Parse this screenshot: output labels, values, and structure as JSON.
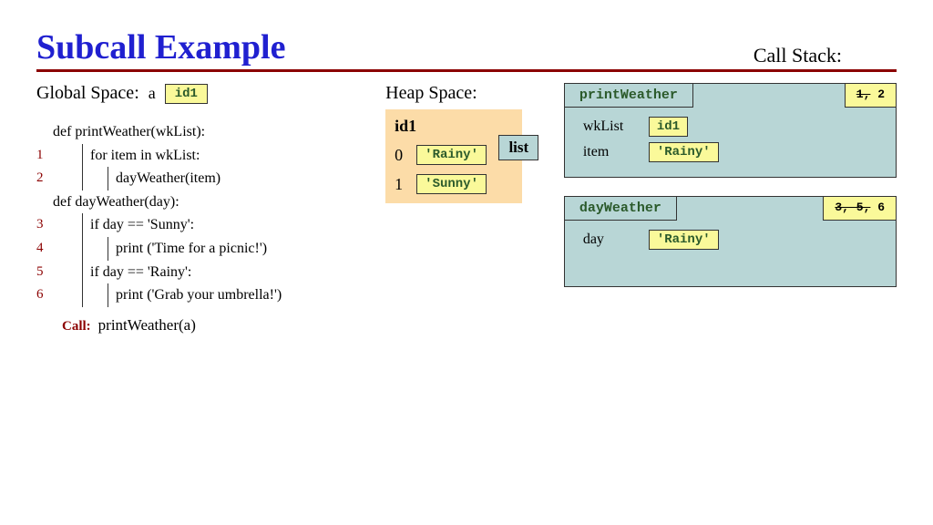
{
  "title": "Subcall Example",
  "callstack_label": "Call Stack:",
  "global": {
    "label": "Global Space:",
    "var_name": "a",
    "var_value": "id1"
  },
  "code": {
    "lines": [
      {
        "ln": "",
        "indent": 0,
        "text": "def printWeather(wkList):"
      },
      {
        "ln": "1",
        "indent": 1,
        "text": "for item in wkList:"
      },
      {
        "ln": "2",
        "indent": 2,
        "text": "dayWeather(item)"
      },
      {
        "ln": "",
        "indent": 0,
        "text": "def dayWeather(day):"
      },
      {
        "ln": "3",
        "indent": 1,
        "text": "if day == 'Sunny':"
      },
      {
        "ln": "4",
        "indent": 2,
        "text": "print ('Time for a picnic!')"
      },
      {
        "ln": "5",
        "indent": 1,
        "text": "if day == 'Rainy':"
      },
      {
        "ln": "6",
        "indent": 2,
        "text": "print ('Grab your umbrella!')"
      }
    ],
    "call_label": "Call:",
    "call_text": "printWeather(a)"
  },
  "heap": {
    "label": "Heap Space:",
    "obj_id": "id1",
    "obj_type": "list",
    "items": [
      {
        "idx": "0",
        "val": "'Rainy'"
      },
      {
        "idx": "1",
        "val": "'Sunny'"
      }
    ]
  },
  "stack": [
    {
      "name": "printWeather",
      "counter_struck": "1,",
      "counter_cur": " 2",
      "vars": [
        {
          "name": "wkList",
          "val": "id1"
        },
        {
          "name": "item",
          "val": "'Rainy'"
        }
      ]
    },
    {
      "name": "dayWeather",
      "counter_struck": "3, 5,",
      "counter_cur": " 6",
      "vars": [
        {
          "name": "day",
          "val": "'Rainy'"
        }
      ]
    }
  ]
}
